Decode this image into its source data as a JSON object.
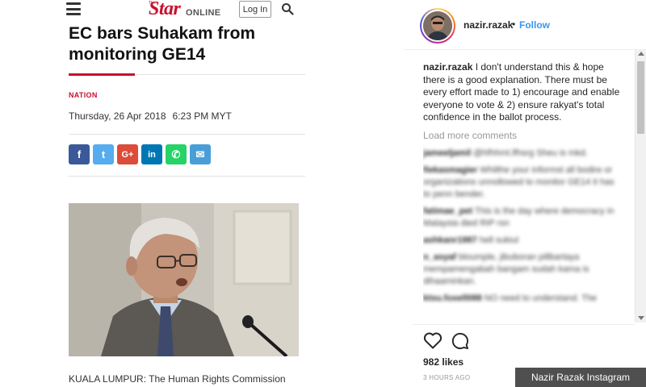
{
  "article": {
    "logo_the": "The",
    "logo_star": "Star",
    "logo_online": "ONLINE",
    "login_label": "Log In",
    "headline": "EC bars Suhakam from monitoring GE14",
    "section": "NATION",
    "date": "Thursday, 26 Apr 2018",
    "time": "6:23 PM MYT",
    "share_buttons": [
      {
        "name": "facebook",
        "glyph": "f",
        "color": "#3b5998"
      },
      {
        "name": "twitter",
        "glyph": "t",
        "color": "#55acee"
      },
      {
        "name": "google-plus",
        "glyph": "G+",
        "color": "#dd4b39"
      },
      {
        "name": "linkedin",
        "glyph": "in",
        "color": "#0077b5"
      },
      {
        "name": "whatsapp",
        "glyph": "✆",
        "color": "#25d366"
      },
      {
        "name": "email",
        "glyph": "✉",
        "color": "#4a9ed8"
      }
    ],
    "lede": "KUALA LUMPUR: The Human Rights Commission"
  },
  "instagram": {
    "username": "nazir.razak",
    "dot": "•",
    "follow_label": "Follow",
    "caption_user": "nazir.razak",
    "caption_text": "I don't understand this & hope there is a good explanation. There must be every effort made to 1) encourage and enable everyone to vote & 2) ensure rakyat's total confidence in the ballot process.",
    "load_more": "Load more comments",
    "blurred_comments": [
      {
        "user": "jameeljamil",
        "text": "@hfhhmt.lfhsrg Sheu is mkd."
      },
      {
        "user": "fiekasmagier",
        "text": "Whilthe your informst all bodire or organizations unnollowed to monitor GE14 it has to penn bender."
      },
      {
        "user": "fatimae_pet",
        "text": "This is the day where democracy in Malaysia died RIP rsn"
      },
      {
        "user": "ashkanr1987",
        "text": "hell sukiul"
      },
      {
        "user": "n_asyaf",
        "text": "bloumple, jibuboran pillbartaya mempamengabah bangam sudah kama is dihaaminkan."
      },
      {
        "user": "ktsu.foxell088",
        "text": "NO need to understand. The"
      }
    ],
    "likes": "982 likes",
    "time_ago": "3 HOURS AGO"
  },
  "credit": "Nazir Razak Instagram",
  "colors": {
    "star_red": "#c8102e",
    "ig_blue": "#3897f0"
  }
}
